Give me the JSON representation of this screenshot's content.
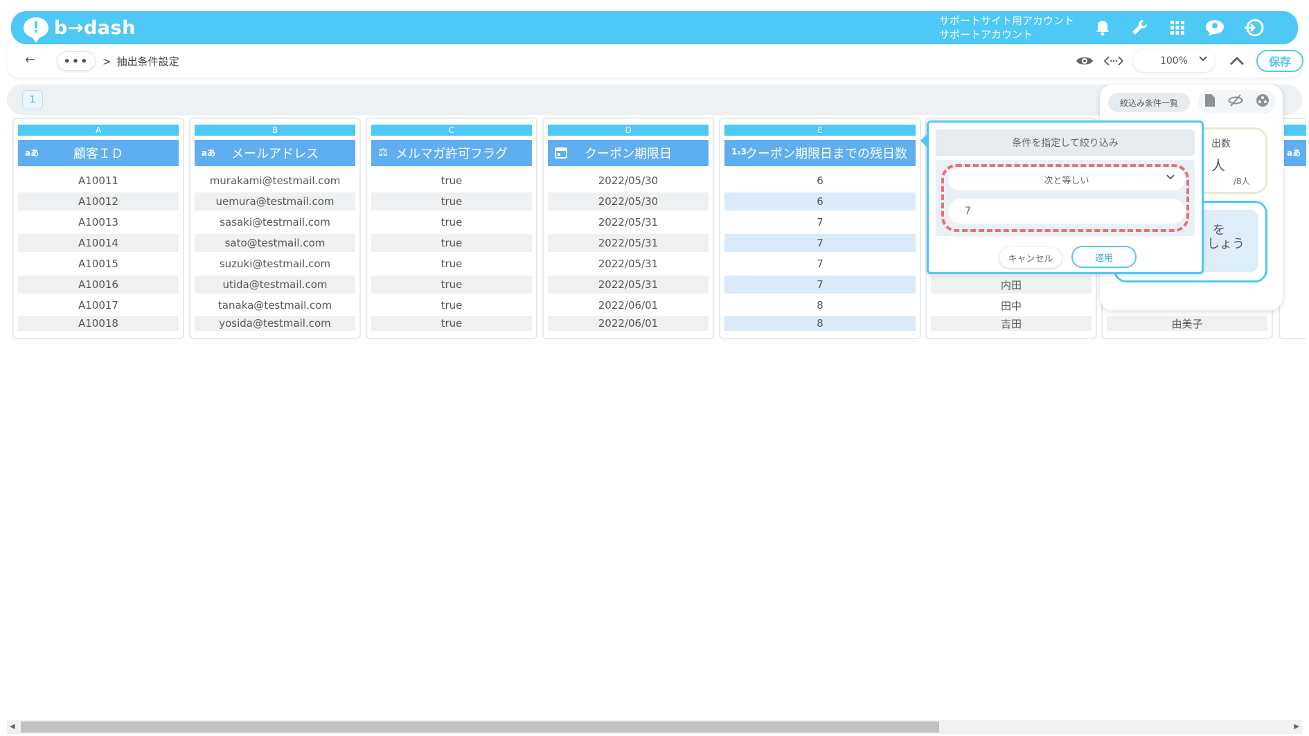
{
  "header": {
    "brand": "b→dash",
    "account_line1": "サポートサイト用アカウント",
    "account_line2": "サポートアカウント",
    "icons": [
      "bell-icon",
      "wrench-icon",
      "grid-icon",
      "user-chat-icon",
      "logout-icon"
    ],
    "accent_color": "#4ec8f5"
  },
  "toolbar": {
    "back_icon": "←",
    "dots": "•••",
    "breadcrumb_sep": ">",
    "breadcrumb": "抽出条件設定",
    "zoom": "100%",
    "save_label": "保存",
    "icons": [
      "eye-icon",
      "code-icon",
      "chevron-down-icon",
      "chevron-up-icon"
    ]
  },
  "sheet": {
    "tab": "1"
  },
  "columns": [
    {
      "letter": "A",
      "icon": "aあ",
      "title": "顧客ＩＤ",
      "cells": [
        "A10011",
        "A10012",
        "A10013",
        "A10014",
        "A10015",
        "A10016",
        "A10017",
        "A10018"
      ]
    },
    {
      "letter": "B",
      "icon": "aあ",
      "title": "メールアドレス",
      "cells": [
        "murakami@testmail.com",
        "uemura@testmail.com",
        "sasaki@testmail.com",
        "sato@testmail.com",
        "suzuki@testmail.com",
        "utida@testmail.com",
        "tanaka@testmail.com",
        "yosida@testmail.com"
      ]
    },
    {
      "letter": "C",
      "icon": "⚖",
      "title": "メルマガ許可フラグ",
      "cells": [
        "true",
        "true",
        "true",
        "true",
        "true",
        "true",
        "true",
        "true"
      ]
    },
    {
      "letter": "D",
      "icon": "▦",
      "title": "クーポン期限日",
      "cells": [
        "2022/05/30",
        "2022/05/30",
        "2022/05/31",
        "2022/05/31",
        "2022/05/31",
        "2022/05/31",
        "2022/06/01",
        "2022/06/01"
      ]
    },
    {
      "letter": "E",
      "icon": "1₂3",
      "title": "クーポン期限日までの残日数",
      "cells": [
        "6",
        "6",
        "7",
        "7",
        "7",
        "7",
        "8",
        "8"
      ]
    }
  ],
  "column_f": {
    "cells": [
      "内田",
      "田中",
      "吉田"
    ]
  },
  "column_g": {
    "cell": "由美子"
  },
  "column_h": {
    "icon": "aあ"
  },
  "filter_popup": {
    "title": "条件を指定して絞り込み",
    "operator": "次と等しい",
    "value": "7",
    "cancel_label": "キャンセル",
    "apply_label": "適用"
  },
  "side_panel": {
    "tab_label": "絞込み条件一覧",
    "card_title": "出数",
    "card_value": "人",
    "card_denominator": "/8人",
    "hint_line1": "を",
    "hint_line2": "しょう"
  }
}
